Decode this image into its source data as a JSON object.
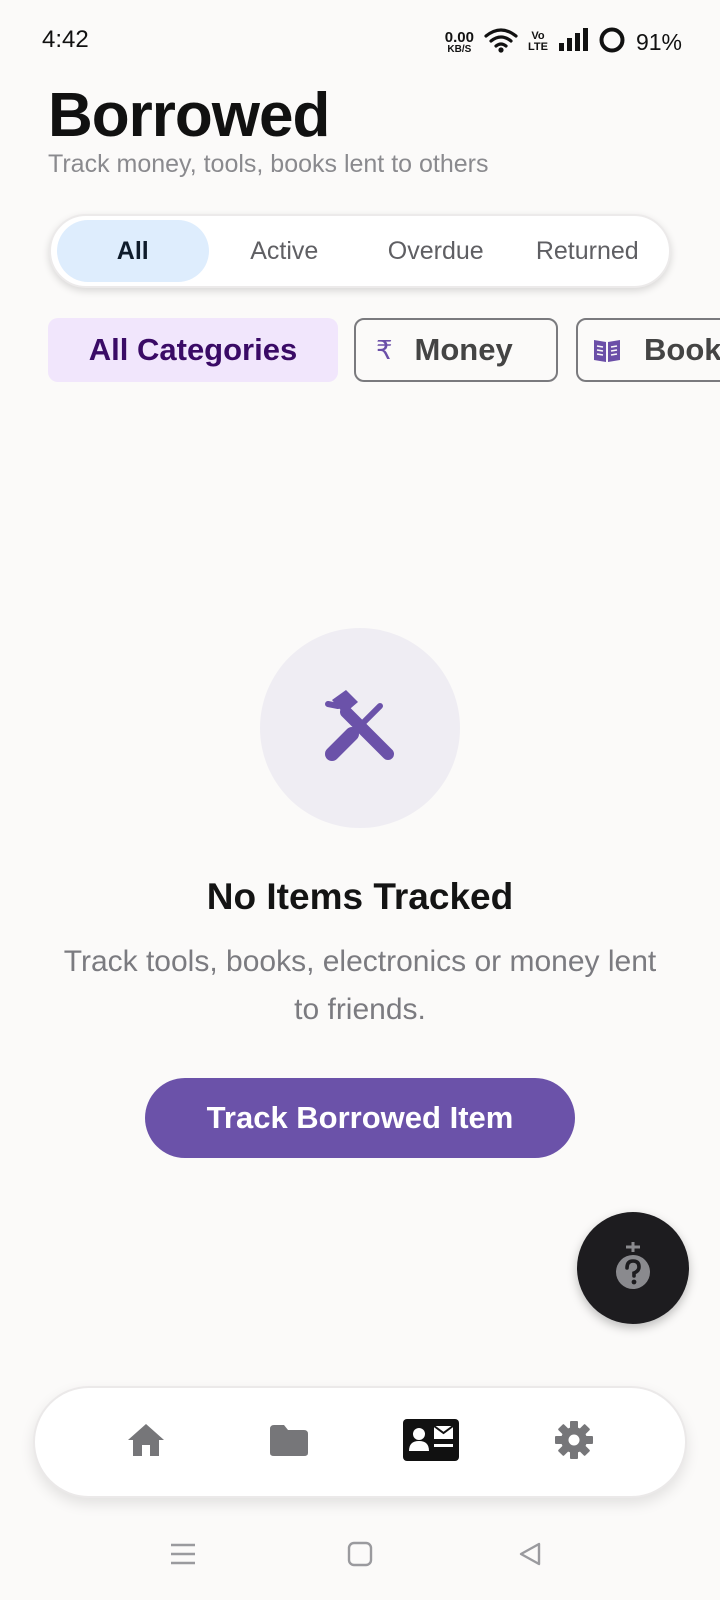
{
  "status_bar": {
    "time": "4:42",
    "net_speed_value": "0.00",
    "net_speed_unit": "KB/S",
    "volte_top": "Vo",
    "volte_bottom": "LTE",
    "battery": "91%"
  },
  "header": {
    "title": "Borrowed",
    "subtitle": "Track money, tools, books lent to others"
  },
  "tabs": [
    {
      "label": "All",
      "active": true
    },
    {
      "label": "Active",
      "active": false
    },
    {
      "label": "Overdue",
      "active": false
    },
    {
      "label": "Returned",
      "active": false
    }
  ],
  "categories": [
    {
      "label": "All Categories",
      "icon": "",
      "selected": true
    },
    {
      "label": "Money",
      "icon": "rupee-icon",
      "icon_glyph": "₹",
      "selected": false
    },
    {
      "label": "Books",
      "icon": "book-icon",
      "selected": false
    }
  ],
  "empty_state": {
    "icon": "tools-icon",
    "title": "No Items Tracked",
    "description": "Track tools, books, electronics or money lent to friends.",
    "button_label": "Track Borrowed Item"
  },
  "fab": {
    "icon": "help-icon"
  },
  "bottom_nav": [
    {
      "icon": "home-icon",
      "active": false
    },
    {
      "icon": "folder-icon",
      "active": false
    },
    {
      "icon": "contact-card-icon",
      "active": true
    },
    {
      "icon": "gear-icon",
      "active": false
    }
  ],
  "colors": {
    "accent": "#6b52a9",
    "tab_active_bg": "#deedfd",
    "chip_selected_bg": "#f1e6fc",
    "chip_selected_text": "#3a0b66",
    "background": "#fbfaf9"
  }
}
